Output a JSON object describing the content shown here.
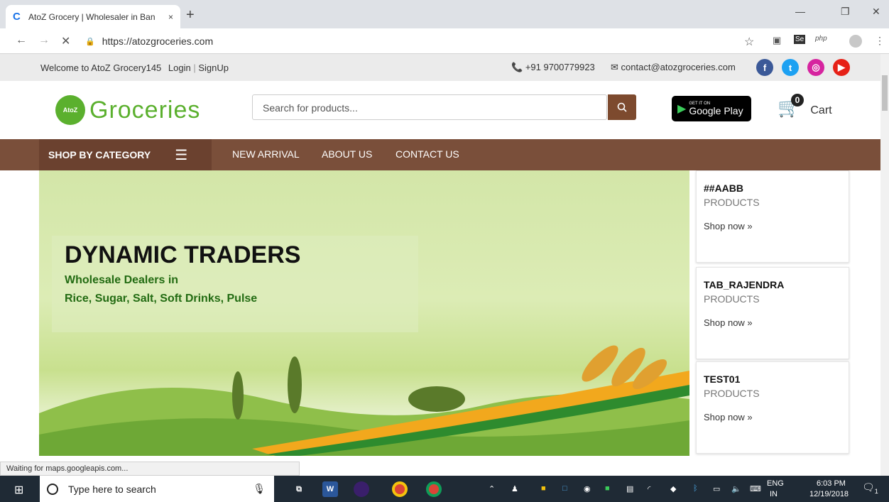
{
  "browser": {
    "tab_title": "AtoZ Grocery | Wholesaler in Ban",
    "tab_close": "×",
    "new_tab": "+",
    "url": "https://atozgroceries.com",
    "status": "Waiting for maps.googleapis.com..."
  },
  "topbar": {
    "welcome": "Welcome to AtoZ Grocery145",
    "login": "Login",
    "separator": "|",
    "signup": "SignUp",
    "phone": "+91 9700779923",
    "email": "contact@atozgroceries.com"
  },
  "header": {
    "logo_badge": "AtoZ",
    "logo_text": "Groceries",
    "search_placeholder": "Search for products...",
    "gplay_small": "GET IT ON",
    "gplay_name": "Google Play",
    "cart_count": "0",
    "cart_label": "Cart"
  },
  "nav": {
    "category": "SHOP BY CATEGORY",
    "links": [
      "NEW ARRIVAL",
      "ABOUT US",
      "CONTACT US"
    ]
  },
  "banner": {
    "title": "DYNAMIC TRADERS",
    "line1": "Wholesale Dealers in",
    "line2": "Rice, Sugar, Salt, Soft Drinks, Pulse"
  },
  "cards": [
    {
      "name": "##AABB",
      "sub": "PRODUCTS",
      "link": "Shop now »"
    },
    {
      "name": "TAB_RAJENDRA",
      "sub": "PRODUCTS",
      "link": "Shop now »"
    },
    {
      "name": "TEST01",
      "sub": "PRODUCTS",
      "link": "Shop now »"
    }
  ],
  "taskbar": {
    "search": "Type here to search",
    "lang1": "ENG",
    "lang2": "IN",
    "time": "6:03 PM",
    "date": "12/19/2018",
    "notif": "1"
  },
  "colors": {
    "brand_green": "#5bb02e",
    "nav_brown": "#7a4f3a",
    "facebook": "#3b5998",
    "twitter": "#1da1f2",
    "instagram": "#d6249f",
    "youtube": "#e62117"
  }
}
